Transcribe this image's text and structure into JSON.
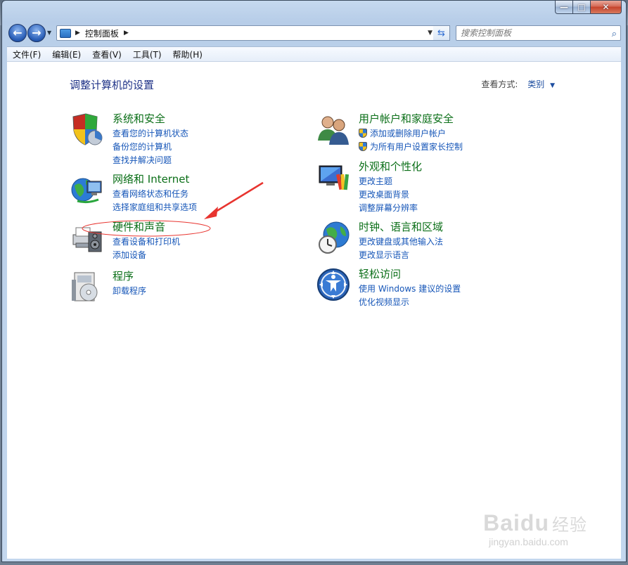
{
  "background_tabs": [
    "",
    "",
    "",
    "",
    "",
    "",
    "",
    "",
    "",
    ""
  ],
  "window": {
    "controls": {
      "minimize": "—",
      "maximize": "□",
      "close": "✕"
    }
  },
  "nav": {
    "back": "←",
    "forward": "→",
    "breadcrumb": [
      "控制面板"
    ],
    "search_placeholder": "搜索控制面板"
  },
  "menu": [
    "文件(F)",
    "编辑(E)",
    "查看(V)",
    "工具(T)",
    "帮助(H)"
  ],
  "content": {
    "title": "调整计算机的设置",
    "view_by_label": "查看方式:",
    "view_by_value": "类别",
    "categories": [
      {
        "title": "系统和安全",
        "icon": "shield-system-icon",
        "links": [
          "查看您的计算机状态",
          "备份您的计算机",
          "查找并解决问题"
        ]
      },
      {
        "title": "网络和 Internet",
        "icon": "network-globe-icon",
        "links": [
          "查看网络状态和任务",
          "选择家庭组和共享选项"
        ]
      },
      {
        "title": "硬件和声音",
        "icon": "printer-hardware-icon",
        "links": [
          "查看设备和打印机",
          "添加设备"
        ]
      },
      {
        "title": "程序",
        "icon": "programs-icon",
        "links": [
          "卸载程序"
        ]
      },
      {
        "title": "用户帐户和家庭安全",
        "icon": "users-icon",
        "links": [
          "添加或删除用户帐户",
          "为所有用户设置家长控制"
        ]
      },
      {
        "title": "外观和个性化",
        "icon": "appearance-monitor-icon",
        "links": [
          "更改主题",
          "更改桌面背景",
          "调整屏幕分辨率"
        ]
      },
      {
        "title": "时钟、语言和区域",
        "icon": "clock-globe-icon",
        "links": [
          "更改键盘或其他输入法",
          "更改显示语言"
        ]
      },
      {
        "title": "轻松访问",
        "icon": "ease-of-access-icon",
        "links": [
          "使用 Windows 建议的设置",
          "优化视频显示"
        ]
      }
    ]
  },
  "watermark": {
    "logo": "Bai",
    "logo2": "du",
    "cn": "经验",
    "url": "jingyan.baidu.com"
  },
  "colors": {
    "link": "#1656b8",
    "category_title": "#0b6f18",
    "annotation": "#e8342f"
  }
}
